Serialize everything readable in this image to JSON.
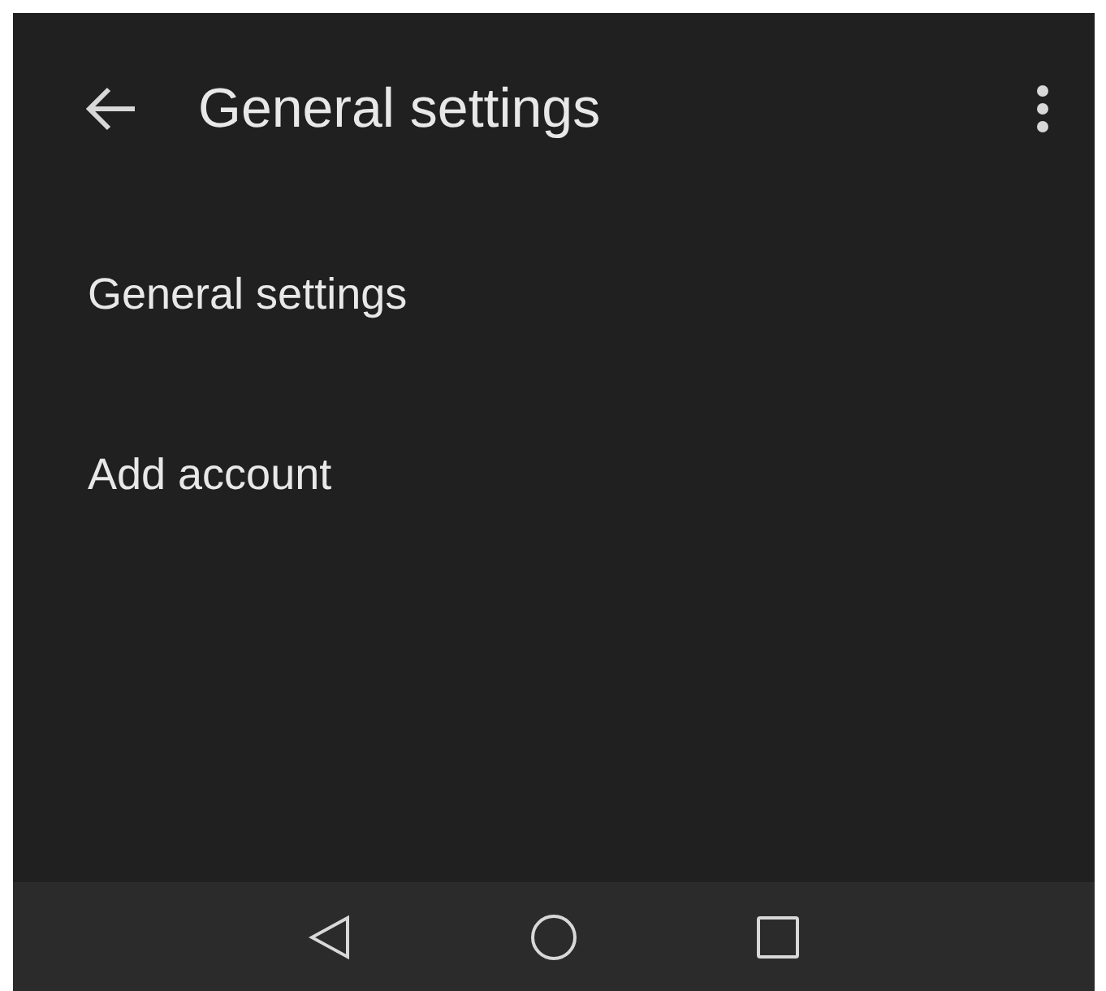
{
  "app_bar": {
    "title": "General settings"
  },
  "items": [
    {
      "label": "General settings"
    },
    {
      "label": "Add account"
    }
  ]
}
